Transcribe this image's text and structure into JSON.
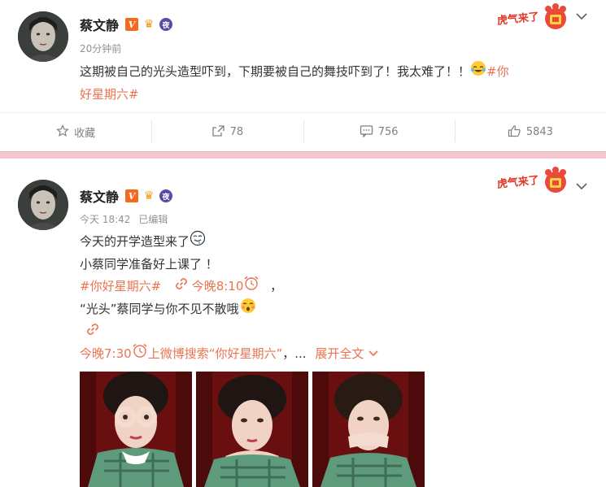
{
  "posts": [
    {
      "author": "蔡文静",
      "badges": {
        "verified": "V",
        "night": "夜"
      },
      "time": "20分钟前",
      "edited": "",
      "text_line1": "这期被自己的光头造型吓到，下期要被自己的舞技吓到了！我太难了！！",
      "hashtag_part1": "#你",
      "hashtag_part2": "好星期六#",
      "promo_label": "虎气来了",
      "actions": {
        "favorite": "收藏",
        "repost": "78",
        "comment": "756",
        "like": "5843"
      }
    },
    {
      "author": "蔡文静",
      "badges": {
        "verified": "V",
        "night": "夜"
      },
      "time": "今天 18:42",
      "edited": "已编辑",
      "line1": "今天的开学造型来了",
      "line2": "小蔡同学准备好上课了 ！",
      "hashtag": "#你好星期六#",
      "tonight_810": "今晚8:10",
      "comma": "，",
      "line4": "“光头”蔡同学与你不见不散哦",
      "tonight_730": "今晚7:30",
      "search_text": "上微博搜索“你好星期六”",
      "ellipsis": "，...",
      "expand": "展开全文",
      "promo_label": "虎气来了"
    }
  ],
  "colors": {
    "accent": "#eb7350",
    "divider": "#f4c6cf",
    "muted": "#939393"
  }
}
